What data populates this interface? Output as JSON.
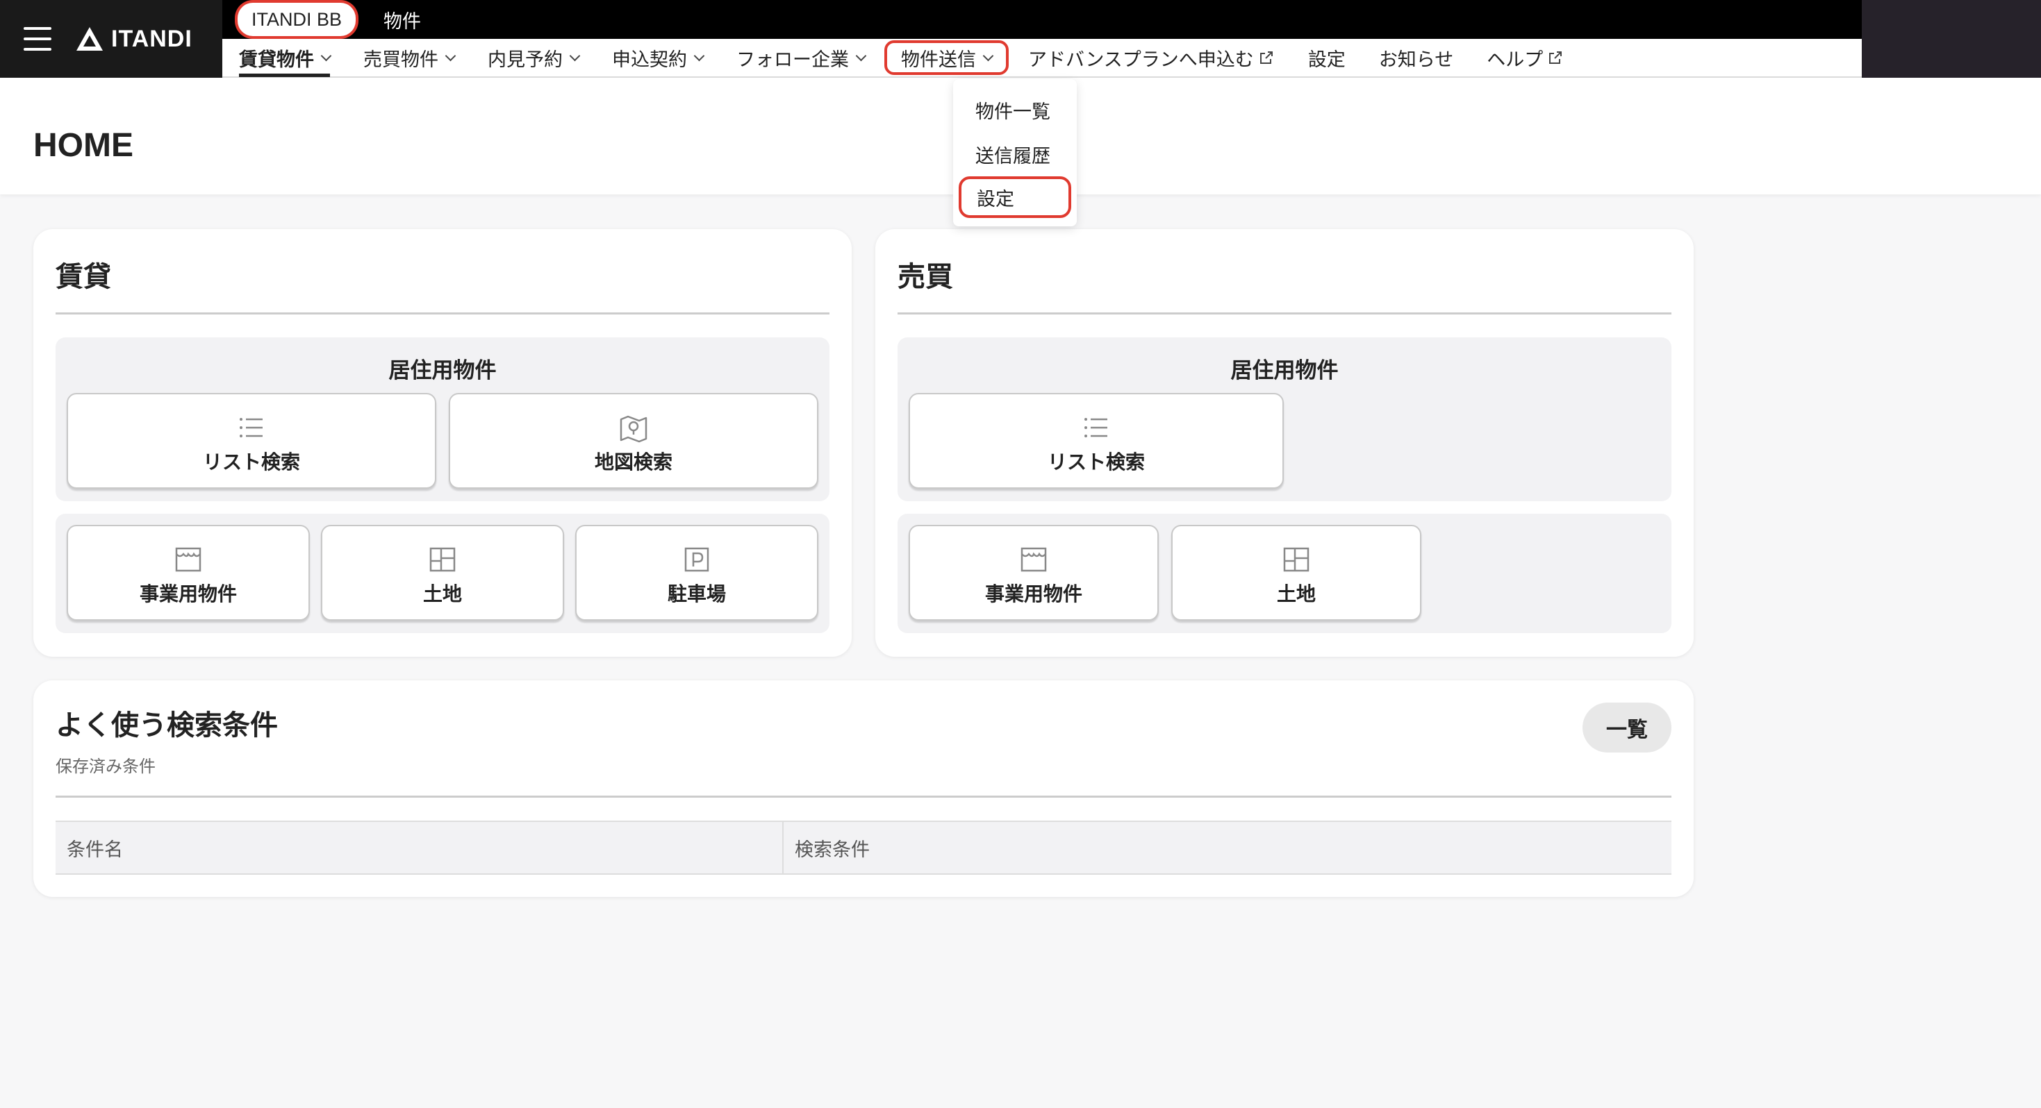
{
  "brand": {
    "logo_text": "ITANDI",
    "menu_icon": "hamburger-menu-icon"
  },
  "service_tabs": [
    {
      "label": "ITANDI BB"
    },
    {
      "label": "物件"
    }
  ],
  "nav": {
    "items": [
      {
        "label": "賃貸物件"
      },
      {
        "label": "売買物件"
      },
      {
        "label": "内見予約"
      },
      {
        "label": "申込契約"
      },
      {
        "label": "フォロー企業"
      },
      {
        "label": "物件送信"
      },
      {
        "label": "アドバンスプランへ申込む"
      },
      {
        "label": "設定"
      },
      {
        "label": "お知らせ"
      },
      {
        "label": "ヘルプ"
      }
    ]
  },
  "dropdown": {
    "items": [
      {
        "label": "物件一覧"
      },
      {
        "label": "送信履歴"
      },
      {
        "label": "設定"
      }
    ]
  },
  "page": {
    "title": "HOME"
  },
  "rental": {
    "title": "賃貸",
    "residential": {
      "title": "居住用物件",
      "list_search": "リスト検索",
      "map_search": "地図検索"
    },
    "commercial": "事業用物件",
    "land": "土地",
    "parking": "駐車場"
  },
  "sale": {
    "title": "売買",
    "residential": {
      "title": "居住用物件",
      "list_search": "リスト検索"
    },
    "commercial": "事業用物件",
    "land": "土地"
  },
  "saved_searches": {
    "title": "よく使う検索条件",
    "subtitle": "保存済み条件",
    "list_button": "一覧",
    "columns": [
      "条件名",
      "検索条件"
    ]
  },
  "colors": {
    "highlight": "#e03a2f",
    "topbar": "#000000",
    "brand_bg": "#1a1a1a"
  }
}
